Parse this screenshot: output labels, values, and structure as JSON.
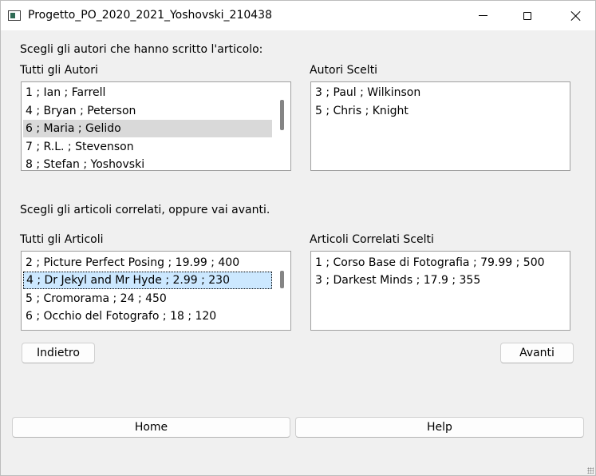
{
  "window": {
    "title": "Progetto_PO_2020_2021_Yoshovski_210438"
  },
  "prompts": {
    "authors_prompt": "Scegli gli autori che hanno scritto l'articolo:",
    "articles_prompt": "Scegli gli articoli correlati, oppure vai avanti."
  },
  "all_authors": {
    "label": "Tutti gli Autori",
    "items": [
      "1 ; Ian ; Farrell",
      "4 ; Bryan ; Peterson",
      "6 ; Maria ; Gelido",
      "7 ; R.L. ; Stevenson",
      "8 ; Stefan ; Yoshovski"
    ],
    "selected": "6 ; Maria ; Gelido"
  },
  "chosen_authors": {
    "label": "Autori Scelti",
    "items": [
      "3 ; Paul ; Wilkinson",
      "5 ; Chris ; Knight"
    ]
  },
  "all_articles": {
    "label": "Tutti gli Articoli",
    "items": [
      "2 ; Picture Perfect Posing ; 19.99 ; 400",
      "4 ; Dr Jekyl and Mr Hyde ; 2.99 ; 230",
      "5 ; Cromorama ; 24 ; 450",
      "6 ; Occhio del Fotografo ; 18 ; 120"
    ],
    "selected": "4 ; Dr Jekyl and Mr Hyde ; 2.99 ; 230"
  },
  "chosen_articles": {
    "label": "Articoli Correlati Scelti",
    "items": [
      "1 ; Corso Base di Fotografia ; 79.99 ; 500",
      "3 ; Darkest Minds ; 17.9 ; 355"
    ]
  },
  "buttons": {
    "back": "Indietro",
    "next": "Avanti",
    "home": "Home",
    "help": "Help"
  },
  "colors": {
    "selected_gray": "#d9d9d9",
    "selected_blue": "#cce8ff",
    "window_bg": "#f0f0f0"
  }
}
